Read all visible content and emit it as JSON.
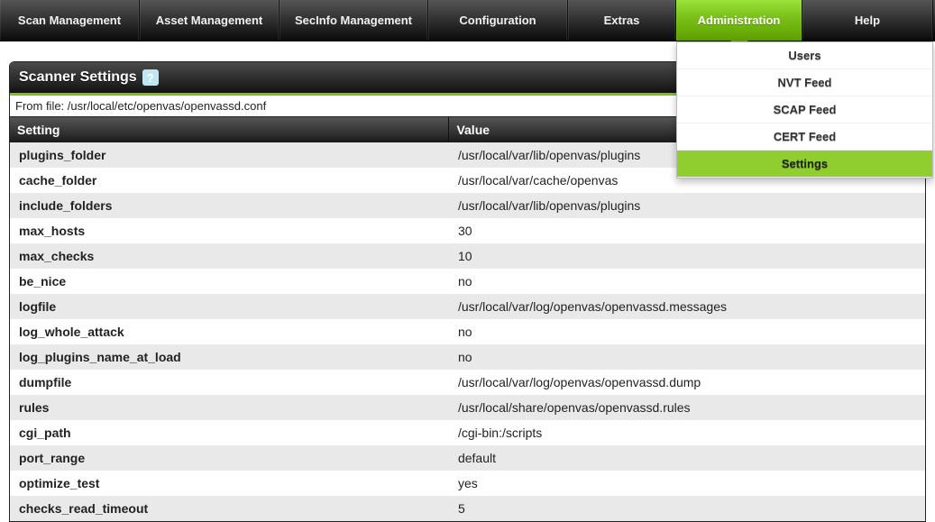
{
  "nav": {
    "scan": "Scan Management",
    "asset": "Asset Management",
    "secinfo": "SecInfo Management",
    "config": "Configuration",
    "extras": "Extras",
    "admin": "Administration",
    "help": "Help"
  },
  "admin_menu": {
    "users": "Users",
    "nvt": "NVT Feed",
    "scap": "SCAP Feed",
    "cert": "CERT Feed",
    "settings": "Settings"
  },
  "panel": {
    "title": "Scanner Settings",
    "help_glyph": "?",
    "file_line": "From file: /usr/local/etc/openvas/openvassd.conf",
    "col_setting": "Setting",
    "col_value": "Value"
  },
  "rows": [
    {
      "key": "plugins_folder",
      "val": "/usr/local/var/lib/openvas/plugins"
    },
    {
      "key": "cache_folder",
      "val": "/usr/local/var/cache/openvas"
    },
    {
      "key": "include_folders",
      "val": "/usr/local/var/lib/openvas/plugins"
    },
    {
      "key": "max_hosts",
      "val": "30"
    },
    {
      "key": "max_checks",
      "val": "10"
    },
    {
      "key": "be_nice",
      "val": "no"
    },
    {
      "key": "logfile",
      "val": "/usr/local/var/log/openvas/openvassd.messages"
    },
    {
      "key": "log_whole_attack",
      "val": "no"
    },
    {
      "key": "log_plugins_name_at_load",
      "val": "no"
    },
    {
      "key": "dumpfile",
      "val": "/usr/local/var/log/openvas/openvassd.dump"
    },
    {
      "key": "rules",
      "val": "/usr/local/share/openvas/openvassd.rules"
    },
    {
      "key": "cgi_path",
      "val": "/cgi-bin:/scripts"
    },
    {
      "key": "port_range",
      "val": "default"
    },
    {
      "key": "optimize_test",
      "val": "yes"
    },
    {
      "key": "checks_read_timeout",
      "val": "5"
    }
  ]
}
